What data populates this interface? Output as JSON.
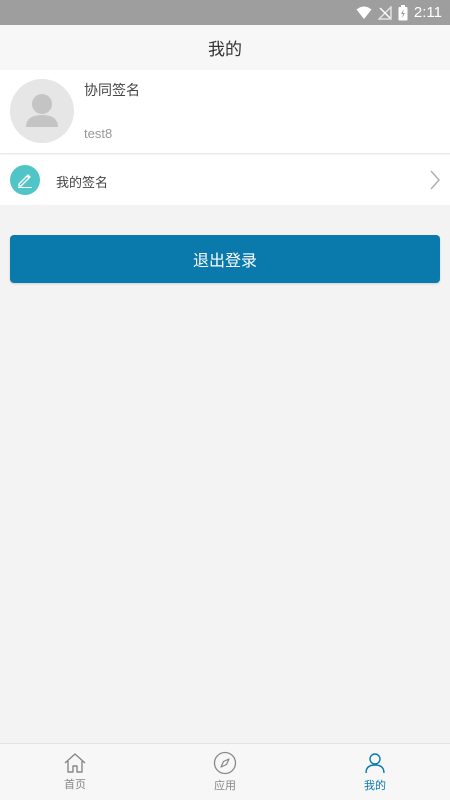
{
  "status_bar": {
    "time": "2:11"
  },
  "header": {
    "title": "我的"
  },
  "profile": {
    "name": "协同签名",
    "username": "test8"
  },
  "menu": {
    "signature_label": "我的签名"
  },
  "actions": {
    "logout_label": "退出登录"
  },
  "tabs": [
    {
      "label": "首页",
      "icon": "home-icon",
      "active": false
    },
    {
      "label": "应用",
      "icon": "compass-icon",
      "active": false
    },
    {
      "label": "我的",
      "icon": "user-icon",
      "active": true
    }
  ],
  "colors": {
    "accent": "#0a7aac",
    "pencil_badge": "#4fc5c8",
    "status_bar": "#9e9e9e",
    "background": "#f3f3f3"
  }
}
